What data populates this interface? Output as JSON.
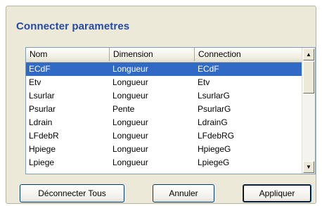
{
  "dialog": {
    "title": "Connecter parametres"
  },
  "table": {
    "columns": [
      "Nom",
      "Dimension",
      "Connection"
    ],
    "rows": [
      [
        "ECdF",
        "Longueur",
        "ECdF"
      ],
      [
        "Etv",
        "Longueur",
        "Etv"
      ],
      [
        "Lsurlar",
        "Longueur",
        "LsurlarG"
      ],
      [
        "Psurlar",
        "Pente",
        "PsurlarG"
      ],
      [
        "Ldrain",
        "Longueur",
        "LdrainG"
      ],
      [
        "LFdebR",
        "Longueur",
        "LFdebRG"
      ],
      [
        "Hpiege",
        "Longueur",
        "HpiegeG"
      ],
      [
        "Lpiege",
        "Longueur",
        "LpiegeG"
      ]
    ],
    "selected_row": 0
  },
  "scrollbar": {
    "up_glyph": "▲",
    "down_glyph": "▼"
  },
  "buttons": {
    "disconnect_all": "Déconnecter Tous",
    "cancel": "Annuler",
    "apply": "Appliquer"
  },
  "colors": {
    "title": "#244aa5",
    "selection": "#316ac5",
    "dialog_bg": "#ece9d8"
  }
}
